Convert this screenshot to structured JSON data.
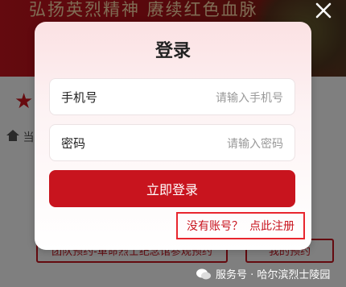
{
  "background": {
    "banner_text": "弘扬英烈精神 赓续红色血脉",
    "breadcrumb": "当",
    "buttons": [
      "团队预约-革命烈士纪念馆参观预约",
      "我的预约"
    ],
    "watermark": "服务号 · 哈尔滨烈士陵园"
  },
  "modal": {
    "title": "登录",
    "phone": {
      "label": "手机号",
      "value": "",
      "placeholder": "请输入手机号"
    },
    "password": {
      "label": "密码",
      "value": "",
      "placeholder": "请输入密码"
    },
    "login_button": "立即登录",
    "register": {
      "prompt": "没有账号？",
      "link": "点此注册"
    }
  },
  "colors": {
    "accent": "#c8141e",
    "highlight_border": "#e8262e"
  },
  "icons": {
    "close": "close-icon",
    "home": "home-icon",
    "logo": "star-icon",
    "watermark": "wechat-icon"
  }
}
